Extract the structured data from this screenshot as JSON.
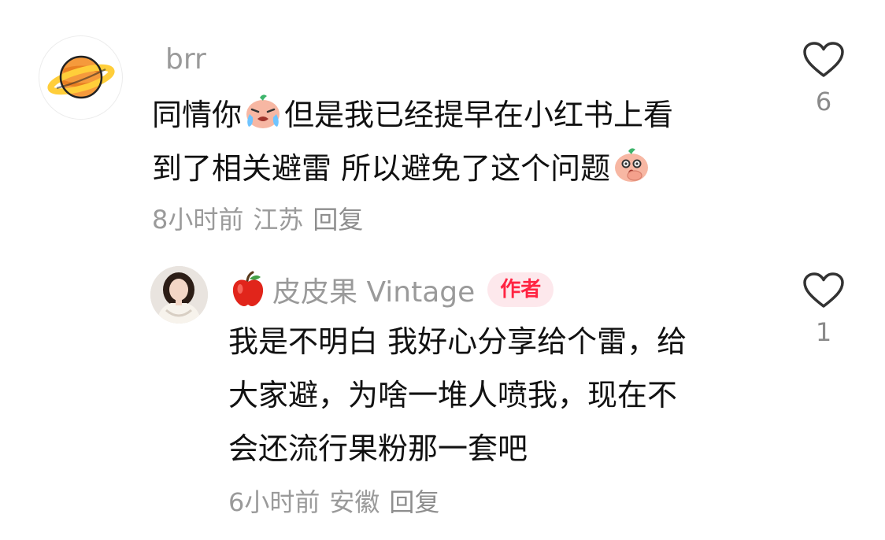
{
  "comments": [
    {
      "username": "brr",
      "avatar": "planet-avatar",
      "text_lines": [
        [
          "同情你",
          "但是我已经提早在小红书上看"
        ],
        [
          "到了相关避雷 所以避免了这个问题"
        ]
      ],
      "emojis": [
        "crying-face-emoji",
        "shocked-face-emoji"
      ],
      "time": "8小时前",
      "location": "江苏",
      "reply_label": "回复",
      "likes": "6"
    },
    {
      "username": "皮皮果 Vintage",
      "username_prefix_icon": "red-apple-icon",
      "badge": "作者",
      "avatar": "woman-avatar",
      "text_lines": [
        "我是不明白 我好心分享给个雷，给",
        "大家避，为啥一堆人喷我，现在不",
        "会还流行果粉那一套吧"
      ],
      "time": "6小时前",
      "location": "安徽",
      "reply_label": "回复",
      "likes": "1"
    }
  ],
  "colors": {
    "meta_gray": "#9a9a9a",
    "badge_text": "#ff2442",
    "badge_bg": "#fde8ec",
    "body_text": "#111111"
  }
}
